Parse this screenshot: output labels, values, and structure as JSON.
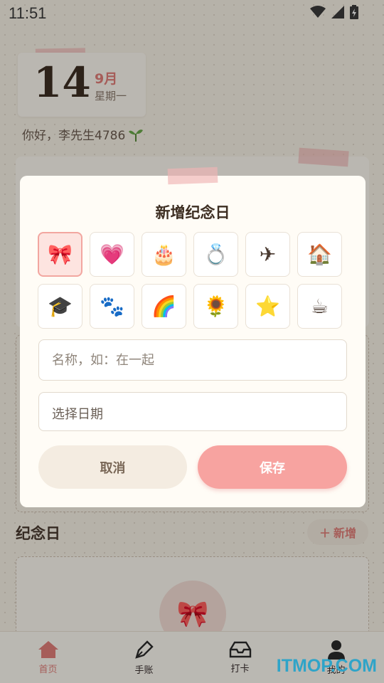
{
  "status_bar": {
    "time": "11:51"
  },
  "date_card": {
    "day": "14",
    "month": "9月",
    "weekday": "星期一"
  },
  "greeting": {
    "text": "你好，李先生4786",
    "icon": "sprout-icon"
  },
  "dialog": {
    "title": "新增纪念日",
    "icons": [
      {
        "name": "ribbon-icon",
        "glyph": "🎀",
        "selected": true
      },
      {
        "name": "heart-icon",
        "glyph": "💗",
        "selected": false
      },
      {
        "name": "cake-icon",
        "glyph": "🎂",
        "selected": false
      },
      {
        "name": "ring-icon",
        "glyph": "💍",
        "selected": false
      },
      {
        "name": "airplane-icon",
        "glyph": "✈",
        "selected": false
      },
      {
        "name": "house-icon",
        "glyph": "🏠",
        "selected": false
      },
      {
        "name": "graduation-cap-icon",
        "glyph": "🎓",
        "selected": false
      },
      {
        "name": "paw-icon",
        "glyph": "🐾",
        "selected": false
      },
      {
        "name": "rainbow-icon",
        "glyph": "🌈",
        "selected": false
      },
      {
        "name": "sunflower-icon",
        "glyph": "🌻",
        "selected": false
      },
      {
        "name": "star-icon",
        "glyph": "⭐",
        "selected": false
      },
      {
        "name": "coffee-cup-icon",
        "glyph": "☕",
        "selected": false
      }
    ],
    "name_placeholder": "名称，如：在一起",
    "date_label": "选择日期",
    "cancel_label": "取消",
    "save_label": "保存"
  },
  "anniversary": {
    "title": "纪念日",
    "add_label": "新增",
    "empty_icon": "🎀"
  },
  "nav": [
    {
      "label": "首页",
      "icon": "home-icon",
      "active": true
    },
    {
      "label": "手账",
      "icon": "pen-icon",
      "active": false
    },
    {
      "label": "打卡",
      "icon": "inbox-icon",
      "active": false
    },
    {
      "label": "我的",
      "icon": "user-icon",
      "active": false
    }
  ],
  "watermark": "ITMOP.COM",
  "colors": {
    "accent": "#f7a3a0",
    "accent_text": "#e07e78",
    "background": "#f6f0e4"
  }
}
